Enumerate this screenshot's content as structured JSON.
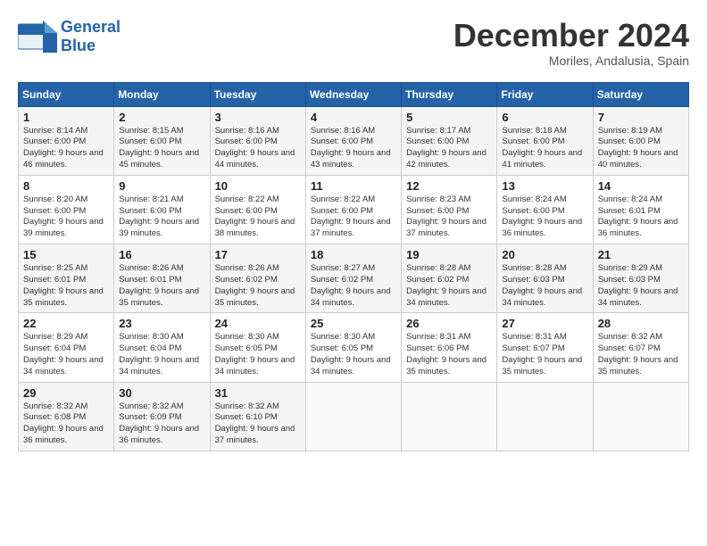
{
  "header": {
    "logo_text_general": "General",
    "logo_text_blue": "Blue",
    "month": "December 2024",
    "location": "Moriles, Andalusia, Spain"
  },
  "weekdays": [
    "Sunday",
    "Monday",
    "Tuesday",
    "Wednesday",
    "Thursday",
    "Friday",
    "Saturday"
  ],
  "weeks": [
    [
      {
        "day": "1",
        "sunrise": "8:14 AM",
        "sunset": "6:00 PM",
        "daylight": "9 hours and 46 minutes."
      },
      {
        "day": "2",
        "sunrise": "8:15 AM",
        "sunset": "6:00 PM",
        "daylight": "9 hours and 45 minutes."
      },
      {
        "day": "3",
        "sunrise": "8:16 AM",
        "sunset": "6:00 PM",
        "daylight": "9 hours and 44 minutes."
      },
      {
        "day": "4",
        "sunrise": "8:16 AM",
        "sunset": "6:00 PM",
        "daylight": "9 hours and 43 minutes."
      },
      {
        "day": "5",
        "sunrise": "8:17 AM",
        "sunset": "6:00 PM",
        "daylight": "9 hours and 42 minutes."
      },
      {
        "day": "6",
        "sunrise": "8:18 AM",
        "sunset": "6:00 PM",
        "daylight": "9 hours and 41 minutes."
      },
      {
        "day": "7",
        "sunrise": "8:19 AM",
        "sunset": "6:00 PM",
        "daylight": "9 hours and 40 minutes."
      }
    ],
    [
      {
        "day": "8",
        "sunrise": "8:20 AM",
        "sunset": "6:00 PM",
        "daylight": "9 hours and 39 minutes."
      },
      {
        "day": "9",
        "sunrise": "8:21 AM",
        "sunset": "6:00 PM",
        "daylight": "9 hours and 39 minutes."
      },
      {
        "day": "10",
        "sunrise": "8:22 AM",
        "sunset": "6:00 PM",
        "daylight": "9 hours and 38 minutes."
      },
      {
        "day": "11",
        "sunrise": "8:22 AM",
        "sunset": "6:00 PM",
        "daylight": "9 hours and 37 minutes."
      },
      {
        "day": "12",
        "sunrise": "8:23 AM",
        "sunset": "6:00 PM",
        "daylight": "9 hours and 37 minutes."
      },
      {
        "day": "13",
        "sunrise": "8:24 AM",
        "sunset": "6:00 PM",
        "daylight": "9 hours and 36 minutes."
      },
      {
        "day": "14",
        "sunrise": "8:24 AM",
        "sunset": "6:01 PM",
        "daylight": "9 hours and 36 minutes."
      }
    ],
    [
      {
        "day": "15",
        "sunrise": "8:25 AM",
        "sunset": "6:01 PM",
        "daylight": "9 hours and 35 minutes."
      },
      {
        "day": "16",
        "sunrise": "8:26 AM",
        "sunset": "6:01 PM",
        "daylight": "9 hours and 35 minutes."
      },
      {
        "day": "17",
        "sunrise": "8:26 AM",
        "sunset": "6:02 PM",
        "daylight": "9 hours and 35 minutes."
      },
      {
        "day": "18",
        "sunrise": "8:27 AM",
        "sunset": "6:02 PM",
        "daylight": "9 hours and 34 minutes."
      },
      {
        "day": "19",
        "sunrise": "8:28 AM",
        "sunset": "6:02 PM",
        "daylight": "9 hours and 34 minutes."
      },
      {
        "day": "20",
        "sunrise": "8:28 AM",
        "sunset": "6:03 PM",
        "daylight": "9 hours and 34 minutes."
      },
      {
        "day": "21",
        "sunrise": "8:29 AM",
        "sunset": "6:03 PM",
        "daylight": "9 hours and 34 minutes."
      }
    ],
    [
      {
        "day": "22",
        "sunrise": "8:29 AM",
        "sunset": "6:04 PM",
        "daylight": "9 hours and 34 minutes."
      },
      {
        "day": "23",
        "sunrise": "8:30 AM",
        "sunset": "6:04 PM",
        "daylight": "9 hours and 34 minutes."
      },
      {
        "day": "24",
        "sunrise": "8:30 AM",
        "sunset": "6:05 PM",
        "daylight": "9 hours and 34 minutes."
      },
      {
        "day": "25",
        "sunrise": "8:30 AM",
        "sunset": "6:05 PM",
        "daylight": "9 hours and 34 minutes."
      },
      {
        "day": "26",
        "sunrise": "8:31 AM",
        "sunset": "6:06 PM",
        "daylight": "9 hours and 35 minutes."
      },
      {
        "day": "27",
        "sunrise": "8:31 AM",
        "sunset": "6:07 PM",
        "daylight": "9 hours and 35 minutes."
      },
      {
        "day": "28",
        "sunrise": "8:32 AM",
        "sunset": "6:07 PM",
        "daylight": "9 hours and 35 minutes."
      }
    ],
    [
      {
        "day": "29",
        "sunrise": "8:32 AM",
        "sunset": "6:08 PM",
        "daylight": "9 hours and 36 minutes."
      },
      {
        "day": "30",
        "sunrise": "8:32 AM",
        "sunset": "6:09 PM",
        "daylight": "9 hours and 36 minutes."
      },
      {
        "day": "31",
        "sunrise": "8:32 AM",
        "sunset": "6:10 PM",
        "daylight": "9 hours and 37 minutes."
      },
      null,
      null,
      null,
      null
    ]
  ],
  "labels": {
    "sunrise": "Sunrise:",
    "sunset": "Sunset:",
    "daylight": "Daylight:"
  }
}
